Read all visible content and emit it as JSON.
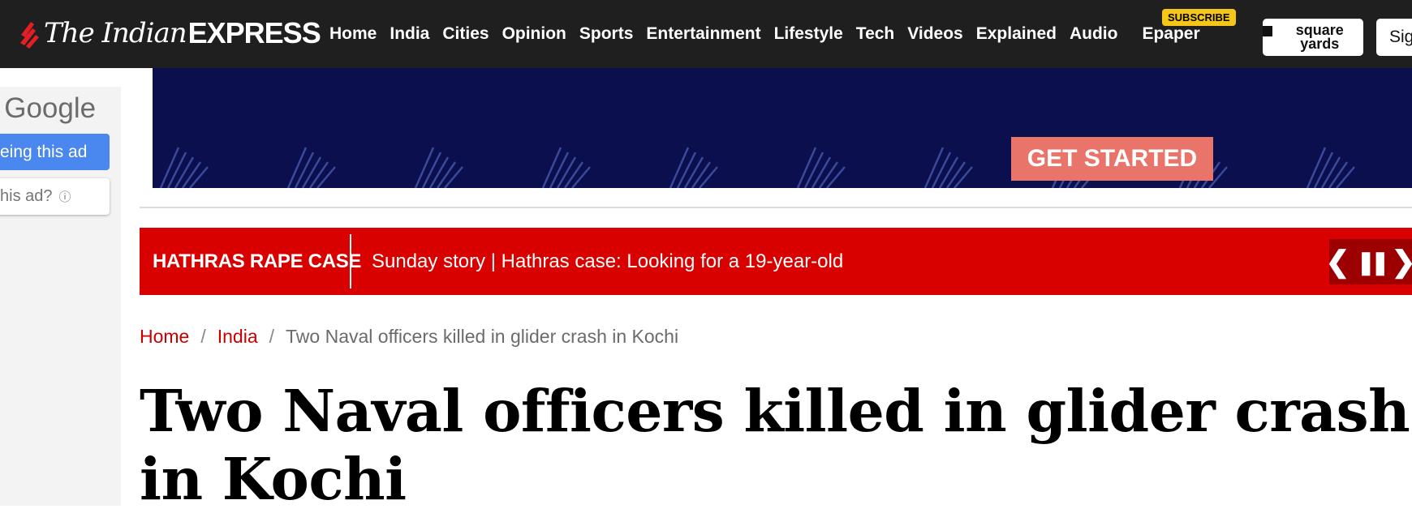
{
  "header": {
    "logo_the": "The Indian",
    "logo_express": "EXPRESS",
    "nav": [
      {
        "label": "Home"
      },
      {
        "label": "India"
      },
      {
        "label": "Cities"
      },
      {
        "label": "Opinion"
      },
      {
        "label": "Sports"
      },
      {
        "label": "Entertainment"
      },
      {
        "label": "Lifestyle"
      },
      {
        "label": "Tech"
      },
      {
        "label": "Videos"
      },
      {
        "label": "Explained"
      },
      {
        "label": "Audio"
      }
    ],
    "epaper_label": "Epaper",
    "subscribe_badge": "SUBSCRIBE",
    "square_yards_label": "square yards",
    "signin_label": "Sig"
  },
  "ad_left": {
    "by_google": "y Google",
    "stop_seeing": "eing this ad",
    "why_this_ad": "his ad?",
    "info_icon": "ⓘ"
  },
  "banner": {
    "cta": "GET STARTED",
    "background_color": "#0b0f4d",
    "cta_color": "#e8746a"
  },
  "ticker": {
    "label": "HATHRAS RAPE CASE",
    "text": "Sunday story | Hathras case: Looking for a 19-year-old",
    "prev_icon": "❮",
    "pause_icon": "❚❚",
    "next_icon": "❯",
    "color": "#d90000"
  },
  "breadcrumb": {
    "home": "Home",
    "section": "India",
    "separator": "/",
    "current": "Two Naval officers killed in glider crash in Kochi"
  },
  "article": {
    "headline": "Two Naval officers killed in glider crash in Kochi"
  }
}
